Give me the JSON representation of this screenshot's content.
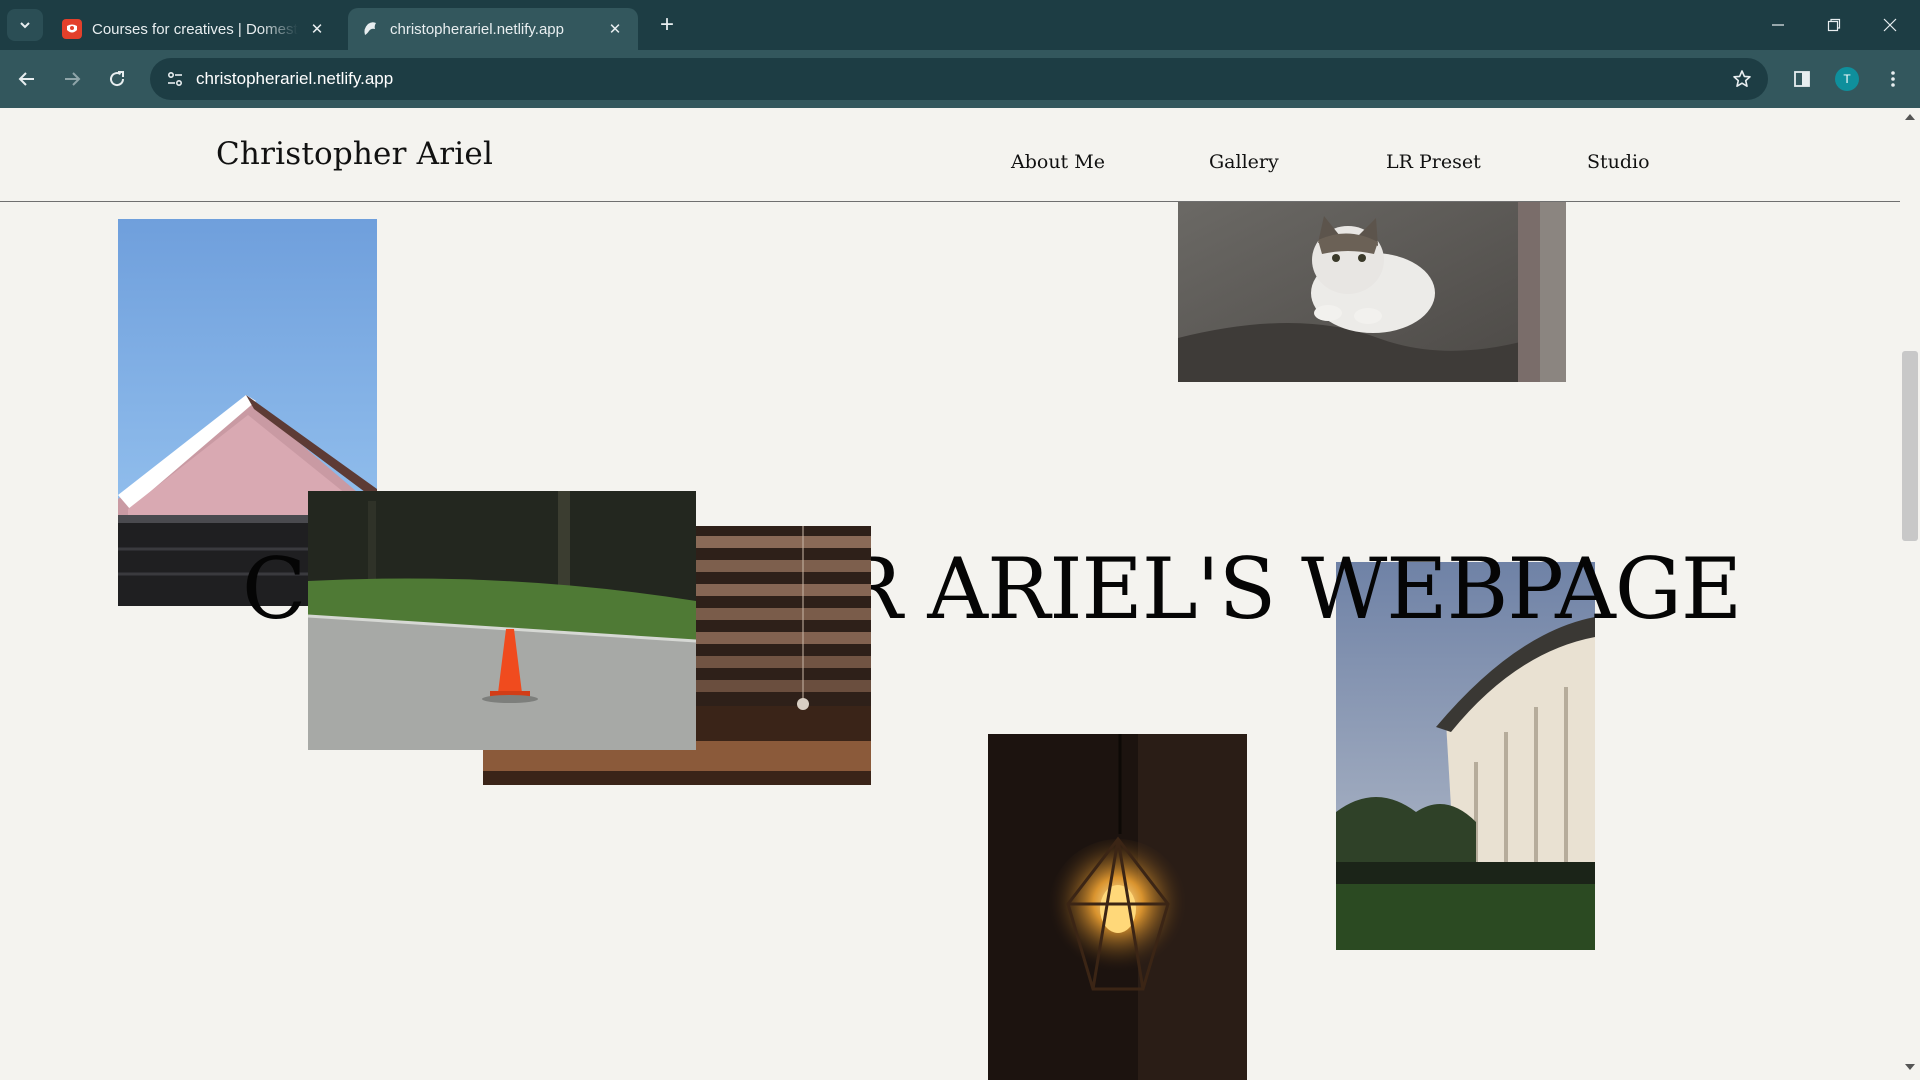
{
  "browser": {
    "tabs": [
      {
        "title": "Courses for creatives | Domestika",
        "favicon": "domestika-icon",
        "active": false
      },
      {
        "title": "christopherariel.netlify.app",
        "favicon": "netlify-icon",
        "active": true
      }
    ],
    "url": "christopherariel.netlify.app",
    "profile_initial": "T",
    "colors": {
      "tabstrip": "#1d3d44",
      "toolbar": "#33575d",
      "omnibox": "#1d3d44",
      "profile": "#0f8f9c"
    }
  },
  "site": {
    "brand": "Christopher Ariel",
    "nav": [
      "About Me",
      "Gallery",
      "LR Preset",
      "Studio"
    ],
    "hero_title": "CHRISTOPHER ARIEL'S WEBPAGE",
    "background": "#f4f3ef",
    "photos": [
      "house-roof-sky-photo",
      "cat-on-rock-photo",
      "traffic-cone-photo",
      "window-blinds-photo",
      "stadium-photo",
      "hanging-bulb-photo"
    ]
  }
}
